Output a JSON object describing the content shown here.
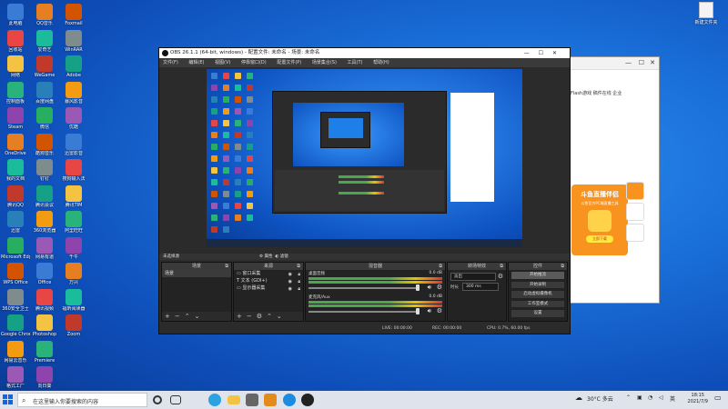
{
  "desktop": {
    "icons_col1": [
      "此电脑",
      "回收站",
      "网络",
      "控制面板",
      "Steam",
      "OneDrive",
      "我的文档",
      "腾讯QQ",
      "迅雷",
      "Microsoft Edge",
      "WPS Office",
      "360安全卫士",
      "Google Chrome",
      "网易云音乐",
      "格式工厂"
    ],
    "icons_col2": [
      "QQ音乐",
      "爱奇艺",
      "WeGame",
      "百度网盘",
      "微信",
      "酷狗音乐",
      "钉钉",
      "腾讯会议",
      "360浏览器",
      "网易有道",
      "Office",
      "腾讯视频",
      "Photoshop",
      "Premiere",
      "向日葵"
    ],
    "icons_col3": [
      "Foxmail",
      "WinRAR",
      "Adobe",
      "暴风影音",
      "优酷",
      "迅雷影音",
      "搜狗输入法",
      "腾讯TIM",
      "阿里旺旺",
      "千牛",
      "万兴",
      "福昕阅读器",
      "Zoom"
    ],
    "right_icon": "新建文件夹"
  },
  "bg_window": {
    "links": "Flash游戏    稿件在线    企业",
    "promo_title": "斗鱼直播伴侣",
    "promo_sub": "斗鱼官方PC端直播工具",
    "promo_btn": "立即下载"
  },
  "obs": {
    "title": "OBS 26.1.1 (64-bit, windows) - 配置文件: 未命名 - 场景: 未命名",
    "menu": [
      "文件(F)",
      "编辑(E)",
      "视图(V)",
      "停靠窗口(D)",
      "配置文件(P)",
      "场景集合(S)",
      "工具(T)",
      "帮助(H)"
    ],
    "dock_label": "未选择源",
    "props_label": "属性",
    "filters_label": "滤镜",
    "scenes_title": "场景",
    "scenes": [
      "场景"
    ],
    "sources_title": "来源",
    "sources": [
      "窗口采集",
      "文本 (GDI+)",
      "显示器采集"
    ],
    "mixer_title": "混音器",
    "mixer": [
      {
        "name": "桌面音频",
        "db": "0.0 dB"
      },
      {
        "name": "麦克风/Aux",
        "db": "0.0 dB"
      }
    ],
    "transitions_title": "转场特效",
    "transition_value": "淡出",
    "duration_label": "时长",
    "duration_value": "300 ms",
    "controls_title": "控件",
    "controls": [
      "开始推流",
      "开始录制",
      "启动虚拟摄像机",
      "工作室模式",
      "设置",
      "退出"
    ],
    "status": {
      "live": "LIVE: 00:00:00",
      "rec": "REC: 00:00:00",
      "cpu": "CPU: 0.7%, 60.00 fps"
    }
  },
  "taskbar": {
    "search_placeholder": "在这里输入你要搜索的内容",
    "weather": "30°C 多云",
    "time": "18:15",
    "date": "2021/7/9",
    "ime": "英"
  },
  "colors": {
    "accent": "#1b64d8",
    "obs_bg": "#2b2b2b",
    "promo": "#f7931e"
  }
}
